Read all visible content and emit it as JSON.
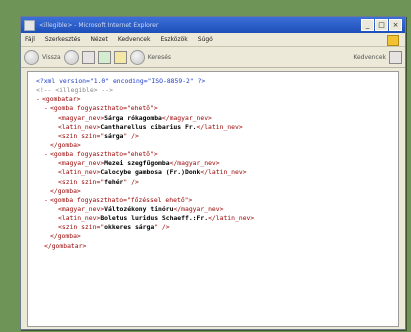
{
  "window": {
    "title": "<illegible> - Microsoft Internet Explorer",
    "controls": [
      "_",
      "□",
      "×"
    ]
  },
  "menu": {
    "items": [
      "Fájl",
      "Szerkesztés",
      "Nézet",
      "Kedvencek",
      "Eszközök",
      "Súgó"
    ]
  },
  "toolbar": {
    "back_label": "Vissza",
    "search_label": "Keresés",
    "favorites_label": "Kedvencek"
  },
  "xml": {
    "declaration": "<?xml version=\"1.0\" encoding=\"ISO-8859-2\" ?>",
    "comment": "<!-- <illegible> -->",
    "root_open": "<gombatar>",
    "root_close": "</gombatar>",
    "entries": [
      {
        "open": "<gomba fogyaszthato=\"ehető\">",
        "magyar": "Sárga rókagomba",
        "latin": "Cantharellus cibarius Fr.",
        "szin": "sárga",
        "close": "</gomba>"
      },
      {
        "open": "<gomba fogyaszthato=\"ehető\">",
        "magyar": "Mezei szegfűgomba",
        "latin": "Calocybe gambosa (Fr.)Donk",
        "szin": "fehér",
        "close": "</gomba>"
      },
      {
        "open": "<gomba fogyaszthato=\"főzéssel ehető\">",
        "magyar": "Változékony tinóru",
        "latin": "Boletus luridus Schaeff.:Fr.",
        "szin": "okkeres sárga",
        "close": "</gomba>"
      }
    ]
  }
}
